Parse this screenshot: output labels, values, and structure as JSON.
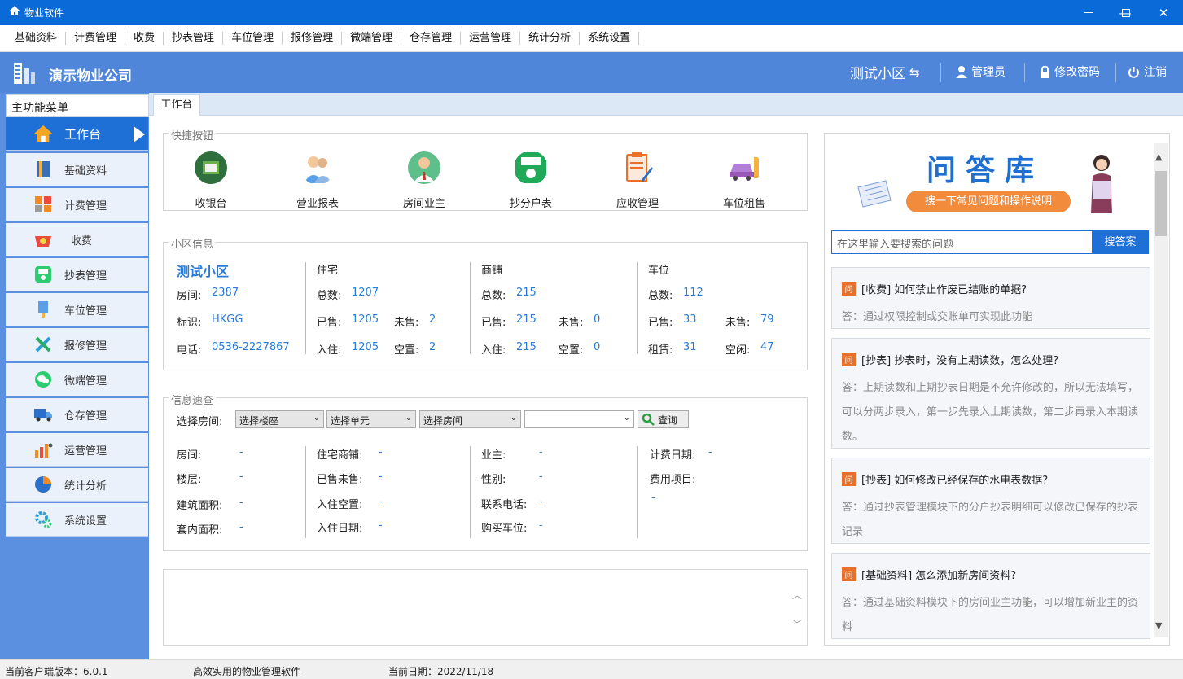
{
  "window": {
    "title": "物业软件",
    "minimize": "—",
    "maximize": "☐",
    "close": "✕"
  },
  "menu": [
    "基础资料",
    "计费管理",
    "收费",
    "抄表管理",
    "车位管理",
    "报修管理",
    "微端管理",
    "仓存管理",
    "运营管理",
    "统计分析",
    "系统设置"
  ],
  "header": {
    "company": "演示物业公司",
    "community": "测试小区",
    "user": "管理员",
    "change_password": "修改密码",
    "logout": "注销"
  },
  "sidebar": {
    "title": "主功能菜单",
    "items": [
      {
        "label": "工作台",
        "icon": "home-icon",
        "active": true
      },
      {
        "label": "基础资料",
        "icon": "book-icon"
      },
      {
        "label": "计费管理",
        "icon": "calculator-icon"
      },
      {
        "label": "收费",
        "icon": "basket-icon"
      },
      {
        "label": "抄表管理",
        "icon": "meter-icon"
      },
      {
        "label": "车位管理",
        "icon": "parking-icon"
      },
      {
        "label": "报修管理",
        "icon": "tools-icon"
      },
      {
        "label": "微端管理",
        "icon": "wechat-icon"
      },
      {
        "label": "仓存管理",
        "icon": "truck-icon"
      },
      {
        "label": "运营管理",
        "icon": "chart-people-icon"
      },
      {
        "label": "统计分析",
        "icon": "pie-chart-icon"
      },
      {
        "label": "系统设置",
        "icon": "gear-icon"
      }
    ]
  },
  "tab": {
    "label": "工作台"
  },
  "quick": {
    "title": "快捷按钮",
    "buttons": [
      {
        "label": "收银台",
        "icon": "cashier-icon"
      },
      {
        "label": "营业报表",
        "icon": "report-people-icon"
      },
      {
        "label": "房间业主",
        "icon": "owner-icon"
      },
      {
        "label": "抄分户表",
        "icon": "meter-reading-icon"
      },
      {
        "label": "应收管理",
        "icon": "clipboard-icon"
      },
      {
        "label": "车位租售",
        "icon": "car-icon"
      }
    ]
  },
  "community": {
    "title": "小区信息",
    "name": "测试小区",
    "room_label": "房间:",
    "room": "2387",
    "id_label": "标识:",
    "id": "HKGG",
    "phone_label": "电话:",
    "phone": "0536-2227867",
    "blocks": [
      {
        "title": "住宅",
        "total_label": "总数:",
        "total": "1207",
        "sold_label": "已售:",
        "sold": "1205",
        "unsold_label": "未售:",
        "unsold": "2",
        "in_label": "入住:",
        "in": "1205",
        "empty_label": "空置:",
        "empty": "2"
      },
      {
        "title": "商铺",
        "total_label": "总数:",
        "total": "215",
        "sold_label": "已售:",
        "sold": "215",
        "unsold_label": "未售:",
        "unsold": "0",
        "in_label": "入住:",
        "in": "215",
        "empty_label": "空置:",
        "empty": "0"
      },
      {
        "title": "车位",
        "total_label": "总数:",
        "total": "112",
        "sold_label": "已售:",
        "sold": "33",
        "unsold_label": "未售:",
        "unsold": "79",
        "in_label": "租赁:",
        "in": "31",
        "empty_label": "空闲:",
        "empty": "47"
      }
    ]
  },
  "lookup": {
    "title": "信息速查",
    "select_label": "选择房间:",
    "building": "选择楼座",
    "unit": "选择单元",
    "room": "选择房间",
    "free": "",
    "query": "查询",
    "fields": [
      [
        "房间:",
        "-"
      ],
      [
        "楼层:",
        "-"
      ],
      [
        "建筑面积:",
        "-"
      ],
      [
        "套内面积:",
        "-"
      ],
      [
        "住宅商铺:",
        "-"
      ],
      [
        "已售未售:",
        "-"
      ],
      [
        "入住空置:",
        "-"
      ],
      [
        "入住日期:",
        "-"
      ],
      [
        "业主:",
        "-"
      ],
      [
        "性别:",
        "-"
      ],
      [
        "联系电话:",
        "-"
      ],
      [
        "购买车位:",
        "-"
      ],
      [
        "计费日期:",
        "-"
      ],
      [
        "费用项目:",
        ""
      ],
      [
        "",
        "-"
      ]
    ]
  },
  "faq": {
    "banner_title": "问答库",
    "banner_sub": "搜一下常见问题和操作说明",
    "search_placeholder": "在这里输入要搜索的问题",
    "search_button": "搜答案",
    "tag": "问",
    "items": [
      {
        "q": "[收费] 如何禁止作废已结账的单据?",
        "a": "答：通过权限控制或交账单可实现此功能"
      },
      {
        "q": "[抄表] 抄表时，没有上期读数，怎么处理?",
        "a": "答：上期读数和上期抄表日期是不允许修改的，所以无法填写，可以分两步录入，第一步先录入上期读数，第二步再录入本期读数。"
      },
      {
        "q": "[抄表] 如何修改已经保存的水电表数据?",
        "a": "答：通过抄表管理模块下的分户抄表明细可以修改已保存的抄表记录"
      },
      {
        "q": "[基础资料] 怎么添加新房间资料?",
        "a": "答：通过基础资料模块下的房间业主功能，可以增加新业主的资料"
      }
    ]
  },
  "status": {
    "version": "当前客户端版本：6.0.1",
    "slogan": "高效实用的物业管理软件",
    "date": "当前日期：2022/11/18"
  }
}
